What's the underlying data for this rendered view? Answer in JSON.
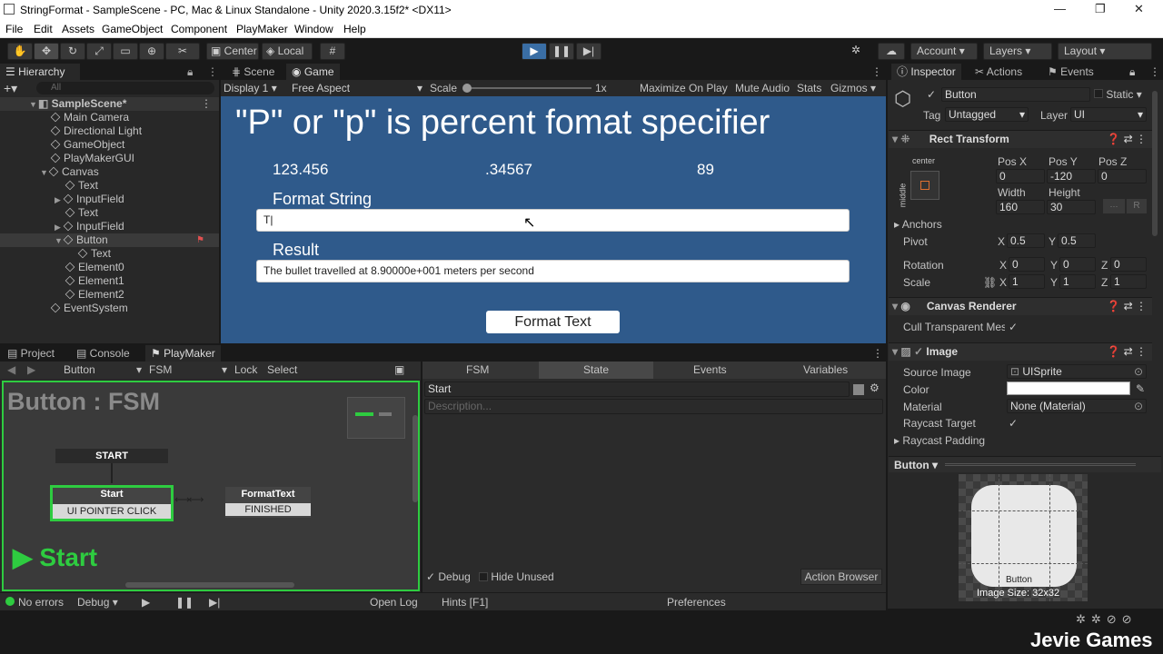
{
  "titlebar": {
    "title": "StringFormat - SampleScene - PC, Mac & Linux Standalone - Unity 2020.3.15f2* <DX11>",
    "min": "—",
    "max": "❐",
    "close": "✕"
  },
  "menu": [
    "File",
    "Edit",
    "Assets",
    "GameObject",
    "Component",
    "PlayMaker",
    "Window",
    "Help"
  ],
  "toolbar": {
    "center": "Center",
    "local": "Local",
    "account": "Account",
    "layers": "Layers",
    "layout": "Layout"
  },
  "hierarchy": {
    "tab": "Hierarchy",
    "search_placeholder": "All",
    "scene": "SampleScene*",
    "items": [
      "Main Camera",
      "Directional Light",
      "GameObject",
      "PlayMakerGUI",
      "Canvas",
      "Text",
      "InputField",
      "Text",
      "InputField",
      "Button",
      "Text",
      "Element0",
      "Element1",
      "Element2",
      "EventSystem"
    ]
  },
  "game": {
    "tabs": [
      "Scene",
      "Game"
    ],
    "display": "Display 1",
    "aspect": "Free Aspect",
    "scale_label": "Scale",
    "scale_value": "1x",
    "options": [
      "Maximize On Play",
      "Mute Audio",
      "Stats",
      "Gizmos"
    ],
    "heading": "\"P\" or \"p\" is percent fomat specifier",
    "values": [
      "123.456",
      ".34567",
      "89"
    ],
    "format_label": "Format String",
    "format_value": "T",
    "result_label": "Result",
    "result_value": "The bullet travelled at 8.90000e+001 meters per second",
    "button": "Format Text"
  },
  "bottom": {
    "tabs": [
      "Project",
      "Console",
      "PlayMaker"
    ],
    "object": "Button",
    "fsm": "FSM",
    "lock": "Lock",
    "select": "Select",
    "title": "Button : FSM",
    "start_node": "START",
    "state_name": "Start",
    "state_event": "UI POINTER CLICK",
    "format_name": "FormatText",
    "format_event": "FINISHED",
    "big_label": "Start",
    "inspector_tabs": [
      "FSM",
      "State",
      "Events",
      "Variables"
    ],
    "state_field": "Start",
    "desc_placeholder": "Description...",
    "debug": "Debug",
    "hide_unused": "Hide Unused",
    "action_browser": "Action Browser",
    "status": {
      "errors": "No errors",
      "debug": "Debug",
      "open_log": "Open Log",
      "hints": "Hints [F1]",
      "preferences": "Preferences"
    }
  },
  "inspector": {
    "tabs": [
      "Inspector",
      "Actions",
      "Events"
    ],
    "name": "Button",
    "static": "Static",
    "tag_label": "Tag",
    "tag": "Untagged",
    "layer_label": "Layer",
    "layer": "UI",
    "rect": {
      "title": "Rect Transform",
      "anchor_h": "center",
      "anchor_v": "middle",
      "posx_l": "Pos X",
      "posy_l": "Pos Y",
      "posz_l": "Pos Z",
      "posx": "0",
      "posy": "-120",
      "posz": "0",
      "w_l": "Width",
      "h_l": "Height",
      "w": "160",
      "h": "30",
      "anchors": "Anchors",
      "pivot": "Pivot",
      "pivot_x": "0.5",
      "pivot_y": "0.5",
      "rotation": "Rotation",
      "rot": [
        "0",
        "0",
        "0"
      ],
      "scale": "Scale",
      "sc": [
        "1",
        "1",
        "1"
      ]
    },
    "canvas_renderer": {
      "title": "Canvas Renderer",
      "cull": "Cull Transparent Mes"
    },
    "image": {
      "title": "Image",
      "source_l": "Source Image",
      "source": "UISprite",
      "color_l": "Color",
      "material_l": "Material",
      "material": "None (Material)",
      "raycast_l": "Raycast Target",
      "padding_l": "Raycast Padding"
    },
    "preview": {
      "name": "Button",
      "label": "Button",
      "size": "Image Size: 32x32"
    }
  },
  "watermark": "Jevie Games"
}
